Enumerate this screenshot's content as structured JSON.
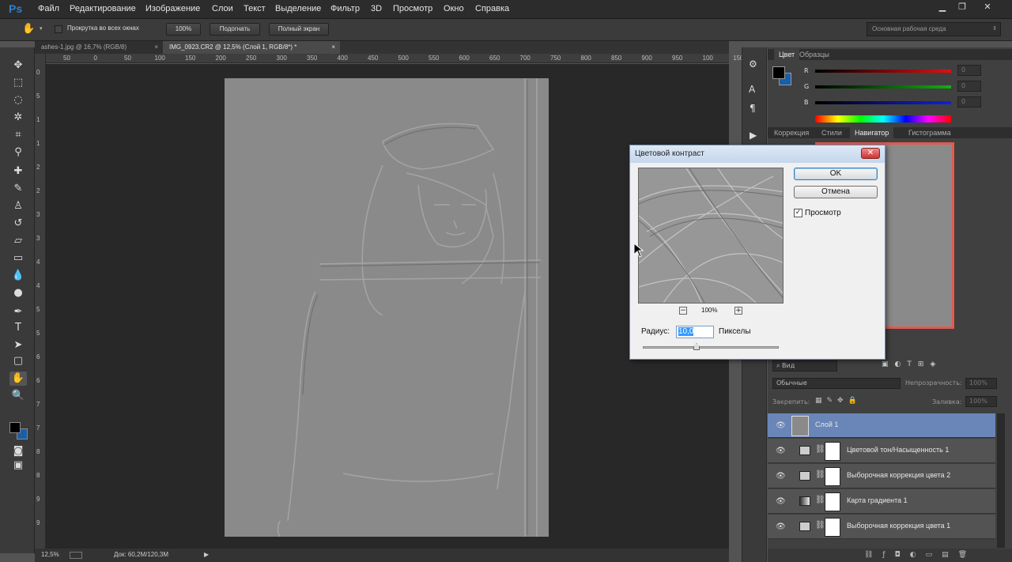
{
  "app": {
    "logo": "Ps"
  },
  "menu": [
    "Файл",
    "Редактирование",
    "Изображение",
    "Слои",
    "Текст",
    "Выделение",
    "Фильтр",
    "3D",
    "Просмотр",
    "Окно",
    "Справка"
  ],
  "window_controls": {
    "minimize": "▁",
    "restore": "❐",
    "close": "✕"
  },
  "options_bar": {
    "scroll_all_label": "Прокрутка во всех окнах",
    "zoom_100": "100%",
    "fit_label": "Подогнать",
    "fullscreen_label": "Полный экран",
    "workspace": "Основная рабочая среда"
  },
  "tabs": [
    {
      "label": "ashes-1.jpg @ 16,7% (RGB/8)",
      "close": "×"
    },
    {
      "label": "IMG_0923.CR2 @ 12,5% (Слой 1, RGB/8*) *",
      "close": "×"
    }
  ],
  "ruler_h": [
    "50",
    "0",
    "50",
    "100",
    "150",
    "200",
    "250",
    "300",
    "350",
    "400",
    "450",
    "500",
    "550",
    "600",
    "650",
    "700",
    "750",
    "800",
    "850",
    "900",
    "950",
    "100",
    "150"
  ],
  "ruler_v": [
    "0",
    "5",
    "1",
    "1",
    "2",
    "2",
    "3",
    "3",
    "4",
    "4",
    "5",
    "5",
    "6",
    "6",
    "7",
    "7",
    "8",
    "8",
    "9",
    "9"
  ],
  "status": {
    "zoom": "12,5%",
    "doc": "Док: 60,2M/120,3M",
    "arrow": "▶"
  },
  "color_panel": {
    "tabs": [
      "Цвет",
      "Образцы"
    ],
    "channels": [
      {
        "label": "R",
        "value": "0",
        "color": "#e01010"
      },
      {
        "label": "G",
        "value": "0",
        "color": "#10b010"
      },
      {
        "label": "B",
        "value": "0",
        "color": "#1020e0"
      }
    ],
    "foreground": "#000000",
    "background": "#1a5ea8"
  },
  "nav_panel": {
    "tabs": [
      "Коррекция",
      "Стили",
      "Навигатор",
      "Гистограмма"
    ]
  },
  "layers_panel": {
    "kind_filter": "Вид",
    "blend_mode": "Обычные",
    "opacity_label": "Непрозрачность:",
    "opacity_value": "100%",
    "lock_label": "Закрепить:",
    "fill_label": "Заливка:",
    "fill_value": "100%",
    "layers": [
      {
        "name": "Слой 1",
        "selected": true
      },
      {
        "name": "Цветовой тон/Насыщенность 1",
        "selected": false
      },
      {
        "name": "Выборочная коррекция цвета 2",
        "selected": false
      },
      {
        "name": "Карта градиента 1",
        "selected": false
      },
      {
        "name": "Выборочная коррекция цвета 1",
        "selected": false
      }
    ]
  },
  "dialog": {
    "title": "Цветовой контраст",
    "close": "✕",
    "ok": "OK",
    "cancel": "Отмена",
    "preview_label": "Просмотр",
    "preview_checked": "✓",
    "zoom": "100%",
    "zoom_minus": "−",
    "zoom_plus": "+",
    "radius_label": "Радиус:",
    "radius_value": "10,0",
    "radius_unit": "Пикселы"
  }
}
